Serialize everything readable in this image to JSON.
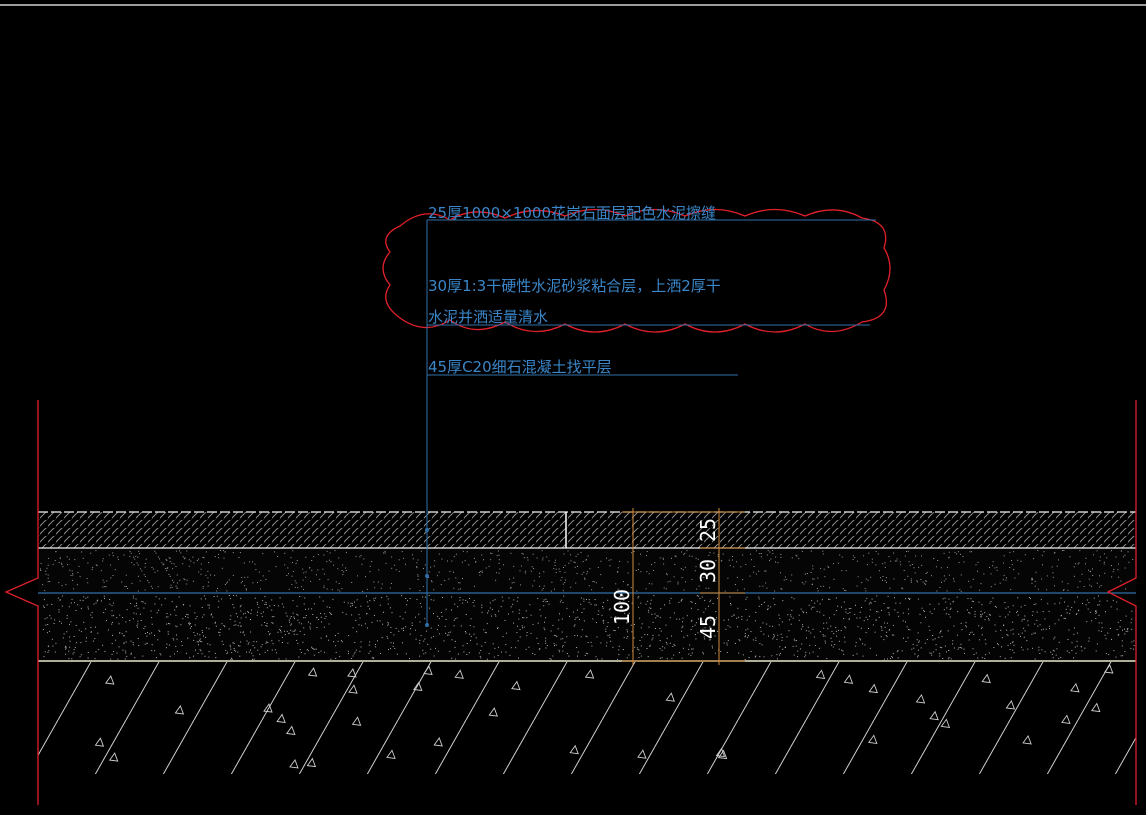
{
  "drawing": {
    "background": "#000000",
    "annotations": [
      {
        "text": "25厚1000×1000花岗石面层配色水泥擦缝"
      },
      {
        "text": "30厚1:3干硬性水泥砂浆粘合层，上洒2厚干"
      },
      {
        "text": "水泥并洒适量清水"
      },
      {
        "text": "45厚C20细石混凝土找平层"
      }
    ],
    "dimensions": {
      "total": "100",
      "layers": [
        "25",
        "30",
        "45"
      ]
    },
    "colors": {
      "leader": "#2f6fa8",
      "annotation_text": "#3a86c8",
      "revision_cloud": "#e0202a",
      "break_lines": "#e0202a",
      "granite_hatch": "#b9b9b9",
      "layer_lines": "#f2f2f2",
      "dimension": "#d08a3a",
      "dimension_text": "#ffffff",
      "subgrade_hatch": "#cfcfcf",
      "top_line": "#d0d0d0"
    }
  }
}
